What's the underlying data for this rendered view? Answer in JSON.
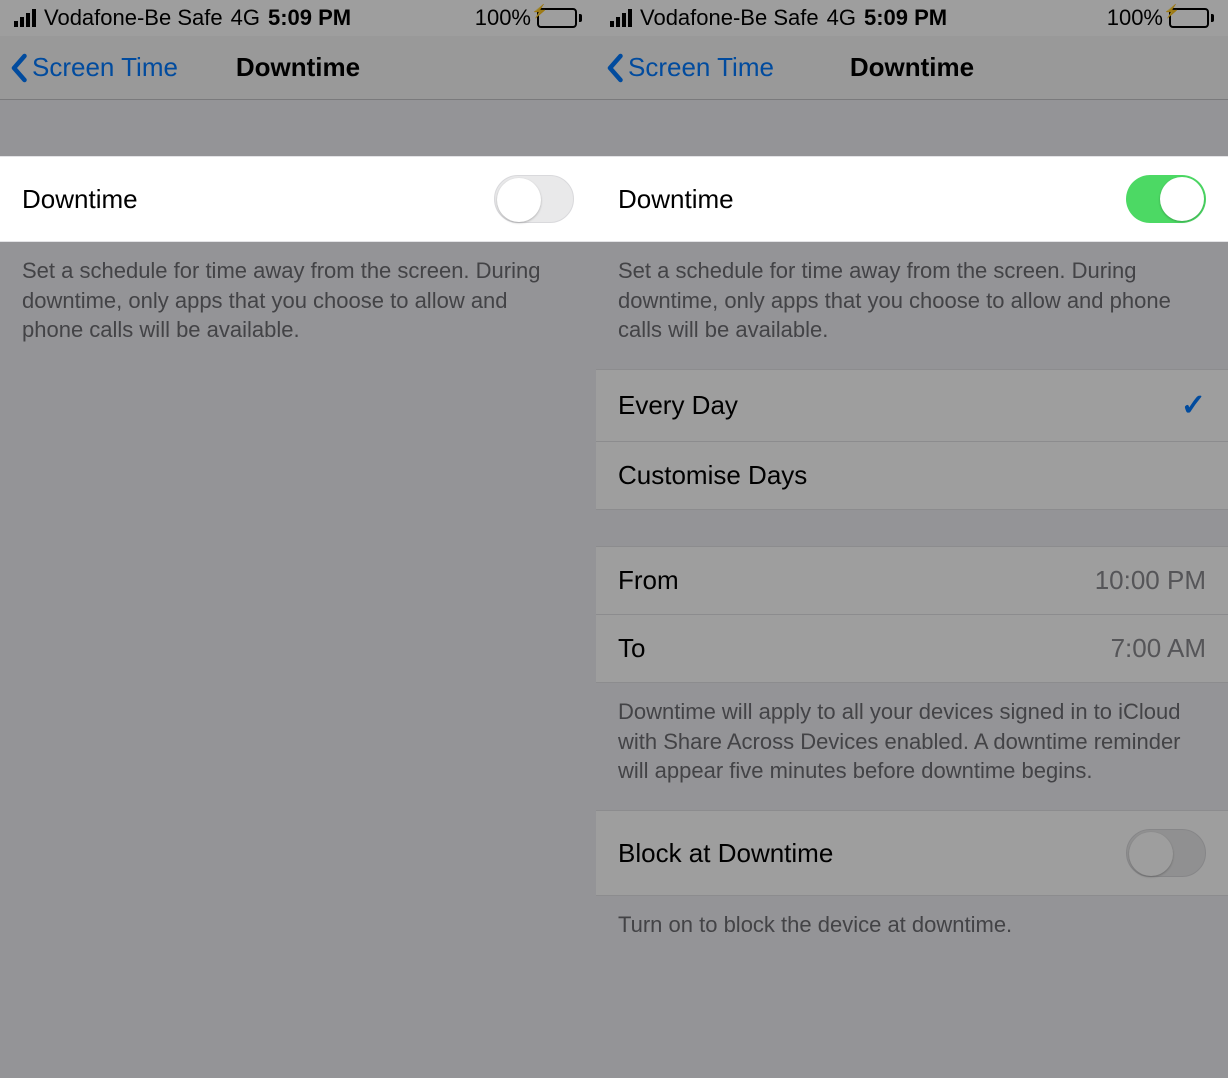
{
  "status": {
    "carrier": "Vodafone-Be Safe",
    "network": "4G",
    "time": "5:09 PM",
    "battery_pct": "100%"
  },
  "nav": {
    "back_label": "Screen Time",
    "title": "Downtime"
  },
  "left": {
    "toggle_label": "Downtime",
    "footer": "Set a schedule for time away from the screen. During downtime, only apps that you choose to allow and phone calls will be available."
  },
  "right": {
    "toggle_label": "Downtime",
    "footer1": "Set a schedule for time away from the screen. During downtime, only apps that you choose to allow and phone calls will be available.",
    "every_day": "Every Day",
    "custom_days": "Customise Days",
    "from_label": "From",
    "from_value": "10:00 PM",
    "to_label": "To",
    "to_value": "7:00 AM",
    "footer2": "Downtime will apply to all your devices signed in to iCloud with Share Across Devices enabled. A downtime reminder will appear five minutes before downtime begins.",
    "block_label": "Block at Downtime",
    "footer3": "Turn on to block the device at downtime."
  }
}
